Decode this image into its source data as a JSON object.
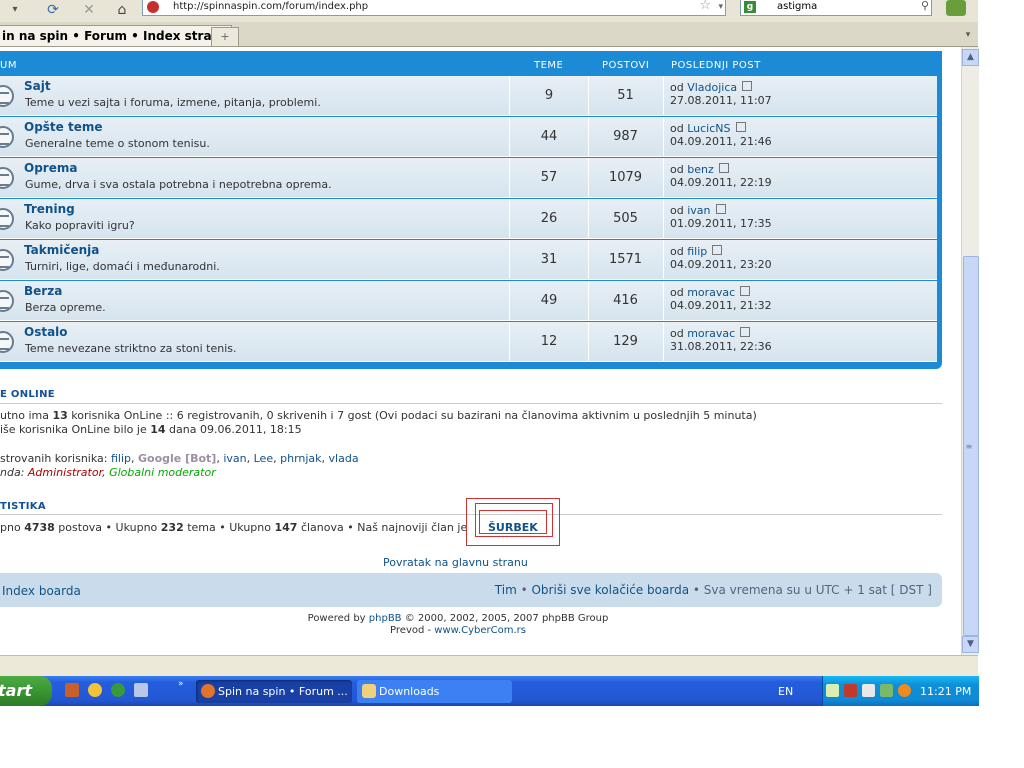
{
  "browser": {
    "url": "http://spinnaspin.com/forum/index.php",
    "search_value": "astigma",
    "search_engine_letter": "g",
    "tab_title": "in na spin • Forum • Index stranica",
    "tab_new": "+",
    "tab_list": "▾"
  },
  "forum": {
    "headers": {
      "forum": "UM",
      "topics": "TEME",
      "posts": "POSTOVI",
      "last": "POSLEDNJI POST"
    },
    "rows": [
      {
        "title": "Sajt",
        "desc": "Teme u vezi sajta i foruma, izmene, pitanja, problemi.",
        "topics": "9",
        "posts": "51",
        "by": "od",
        "user": "Vladojica",
        "date": "27.08.2011, 11:07"
      },
      {
        "title": "Opšte teme",
        "desc": "Generalne teme o stonom tenisu.",
        "topics": "44",
        "posts": "987",
        "by": "od",
        "user": "LucicNS",
        "date": "04.09.2011, 21:46"
      },
      {
        "title": "Oprema",
        "desc": "Gume, drva i sva ostala potrebna i nepotrebna oprema.",
        "topics": "57",
        "posts": "1079",
        "by": "od",
        "user": "benz",
        "date": "04.09.2011, 22:19"
      },
      {
        "title": "Trening",
        "desc": "Kako popraviti igru?",
        "topics": "26",
        "posts": "505",
        "by": "od",
        "user": "ivan",
        "date": "01.09.2011, 17:35"
      },
      {
        "title": "Takmičenja",
        "desc": "Turniri, lige, domaći i međunarodni.",
        "topics": "31",
        "posts": "1571",
        "by": "od",
        "user": "filip",
        "date": "04.09.2011, 23:20"
      },
      {
        "title": "Berza",
        "desc": "Berza opreme.",
        "topics": "49",
        "posts": "416",
        "by": "od",
        "user": "moravac",
        "date": "04.09.2011, 21:32"
      },
      {
        "title": "Ostalo",
        "desc": "Teme nevezane striktno za stoni tenis.",
        "topics": "12",
        "posts": "129",
        "by": "od",
        "user": "moravac",
        "date": "31.08.2011, 22:36"
      }
    ]
  },
  "online": {
    "title": "E ONLINE",
    "line1_a": "utno ima ",
    "line1_count": "13",
    "line1_b": " korisnika OnLine :: 6 registrovanih, 0 skrivenih i 7 gost (Ovi podaci su bazirani na članovima aktivnim u poslednjih 5 minuta)",
    "line2_a": "iše korisnika OnLine bilo je ",
    "line2_count": "14",
    "line2_b": " dana 09.06.2011, 18:15",
    "registered_label": "strovanih korisnika: ",
    "users": [
      "filip",
      "Google [Bot]",
      "ivan",
      "Lee",
      "phrnjak",
      "vlada"
    ],
    "legend_label": "nda: ",
    "legend_admin": "Administrator",
    "legend_gmod": "Globalni moderator"
  },
  "stats": {
    "title": "TISTIKA",
    "a": "pno ",
    "posts": "4738",
    "b": " postova • Ukupno ",
    "topics": "232",
    "c": " tema • Ukupno ",
    "members": "147",
    "d": " članova • Naš najnoviji član je ",
    "newest": "ŠURBEK"
  },
  "back_link": "Povratak na glavnu stranu",
  "footer": {
    "left": "Index boarda",
    "team": "Tim",
    "sep1": " • ",
    "delete_cookies": "Obriši sve kolačiće boarda",
    "sep2": " • ",
    "timezone": "Sva vremena su u UTC + 1 sat [ DST ]"
  },
  "powered": {
    "a": "Powered by ",
    "phpbb": "phpBB",
    "b": " © 2000, 2002, 2005, 2007 phpBB Group",
    "c": "Prevod - ",
    "cyber": "www.CyberCom.rs"
  },
  "taskbar": {
    "start": "tart",
    "more": "»",
    "firefox_task": "Spin na spin • Forum ...",
    "downloads_task": "Downloads",
    "lang": "EN",
    "clock": "11:21 PM"
  },
  "colors": {
    "forum_blue": "#1c8ad5",
    "link": "#105289",
    "taskbar": "#245edc",
    "start_green": "#36912f"
  }
}
